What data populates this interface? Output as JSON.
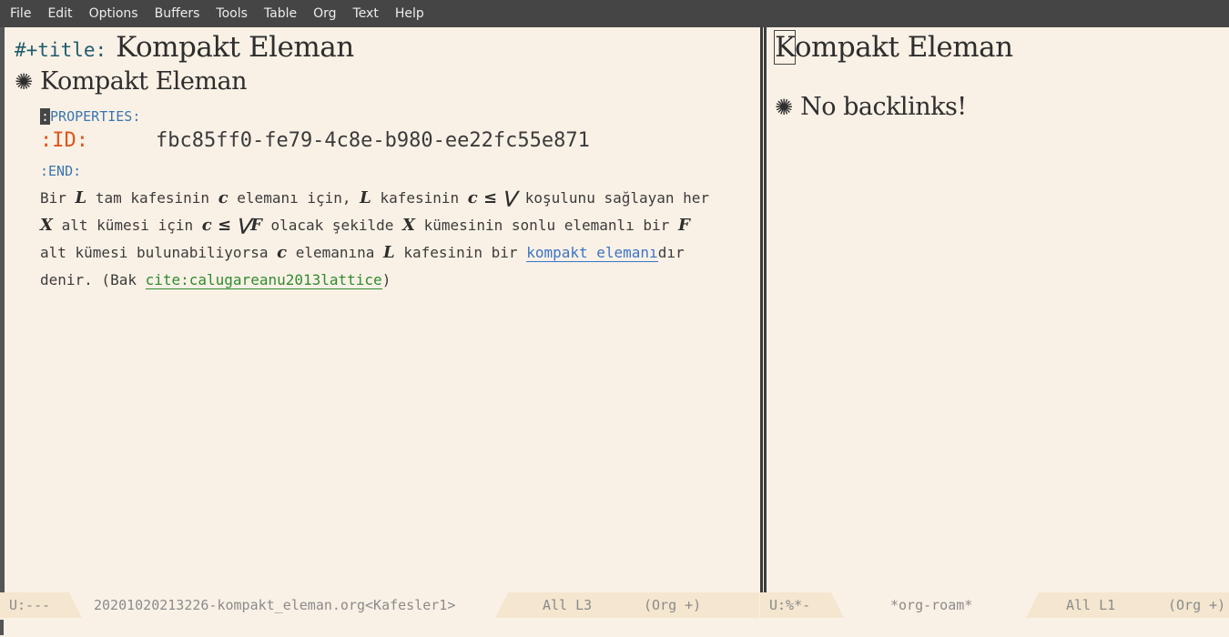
{
  "menubar": {
    "items": [
      "File",
      "Edit",
      "Options",
      "Buffers",
      "Tools",
      "Table",
      "Org",
      "Text",
      "Help"
    ]
  },
  "left_pane": {
    "title_keyword": "#+title:",
    "title": "Kompakt Eleman",
    "heading_bullet": "✺",
    "heading": "Kompakt Eleman",
    "properties_begin_cursor": ":",
    "properties_begin_rest": "PROPERTIES:",
    "id_key": ":ID:",
    "id_value": "fbc85ff0-fe79-4c8e-b980-ee22fc55e871",
    "properties_end": ":END:",
    "paragraph": {
      "l1": [
        "Bir ",
        "L",
        " tam kafesinin ",
        "c",
        " elemanı için, ",
        "L",
        " kafesinin ",
        "c ≤ ⋁",
        " koşulunu sağlayan her"
      ],
      "l2": [
        "X",
        " alt kümesi için ",
        "c ≤ ⋁F",
        " olacak şekilde ",
        "X",
        " kümesinin sonlu elemanlı bir ",
        "F"
      ],
      "l3": [
        "alt kümesi bulunabiliyorsa ",
        "c",
        " elemanına ",
        "L",
        " kafesinin bir ",
        "kompakt elemanı",
        "dır"
      ],
      "l4": [
        "denir. (Bak ",
        "cite:calugareanu2013lattice",
        ")"
      ]
    }
  },
  "right_pane": {
    "title_first": "K",
    "title_rest": "ompakt Eleman",
    "heading_bullet": "✺",
    "heading": "No backlinks!"
  },
  "modeline_left": {
    "state": "U:---",
    "buffer": "20201020213226-kompakt_eleman.org<Kafesler1>",
    "position": "All L3",
    "mode": "(Org +)"
  },
  "modeline_right": {
    "state": "U:%*-",
    "buffer": "*org-roam*",
    "position": "All L1",
    "mode": "(Org +)"
  },
  "colors": {
    "background": "#faf1e6",
    "menubar": "#454545",
    "keyword": "#1f5c6e",
    "property": "#3a76b0",
    "id_key": "#e2541c",
    "link": "#3b74c9",
    "cite": "#2f8b2f"
  }
}
